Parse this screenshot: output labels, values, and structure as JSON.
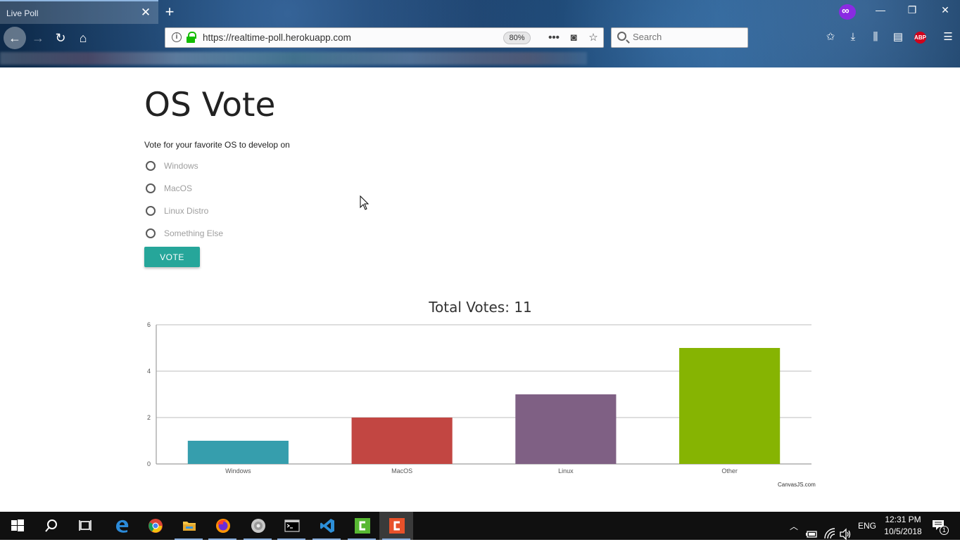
{
  "browser": {
    "tab_title": "Live Poll",
    "tab_close": "✕",
    "new_tab": "+",
    "url": "https://realtime-poll.herokuapp.com",
    "zoom": "80%",
    "search_placeholder": "Search",
    "window_min": "—",
    "window_restore": "❐",
    "window_close": "✕",
    "abp_label": "ABP"
  },
  "page": {
    "title": "OS Vote",
    "subtitle": "Vote for your favorite OS to develop on",
    "options": [
      "Windows",
      "MacOS",
      "Linux Distro",
      "Something Else"
    ],
    "vote_button": "VOTE",
    "chart_title": "Total Votes: 11",
    "chart_credit": "CanvasJS.com"
  },
  "chart_data": {
    "type": "bar",
    "title": "Total Votes: 11",
    "categories": [
      "Windows",
      "MacOS",
      "Linux",
      "Other"
    ],
    "values": [
      1,
      2,
      3,
      5
    ],
    "colors": [
      "#369ead",
      "#c24642",
      "#7f6084",
      "#86b402"
    ],
    "ylim": [
      0,
      6
    ],
    "yticks": [
      0,
      2,
      4,
      6
    ],
    "grid": true,
    "xlabel": "",
    "ylabel": ""
  },
  "taskbar": {
    "time": "12:31 PM",
    "date": "10/5/2018",
    "language": "ENG",
    "notification_count": "1"
  }
}
